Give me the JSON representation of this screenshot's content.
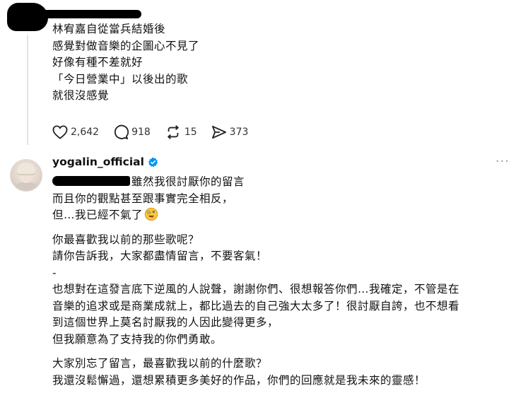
{
  "comment": {
    "lines": [
      "林宥嘉自從當兵結婚後",
      "感覺對做音樂的企圖心不見了",
      "好像有種不差就好",
      "「今日營業中」以後出的歌",
      "就很沒感覺"
    ],
    "actions": {
      "likes": "2,642",
      "replies": "918",
      "reposts": "15",
      "shares": "373"
    }
  },
  "reply": {
    "username": "yogalin_official",
    "more_label": "···",
    "line1_rest": "雖然我很討厭你的留言",
    "line2": "而且你的觀點甚至跟事實完全相反，",
    "line3": "但…我已經不氣了",
    "para2": [
      "你最喜歡我以前的那些歌呢？",
      "請你告訴我，大家都盡情留言，不要客氣！"
    ],
    "separator": "-",
    "para3": [
      "也想對在這發言底下逆風的人說聲，謝謝你們、很想報答你們…我確定，不管是在",
      "音樂的追求或是商業成就上，都比過去的自己強大太多了！很討厭自誇，也不想看",
      "到這個世界上莫名討厭我的人因此變得更多，",
      "但我願意為了支持我的你們勇敢。"
    ],
    "para4": [
      "大家別忘了留言，最喜歡我以前的什麼歌？",
      "我還沒鬆懈過，還想累積更多美好的作品，你們的回應就是我未來的靈感！"
    ]
  },
  "icons": {
    "like": "heart-icon",
    "reply": "comment-icon",
    "repost": "repost-icon",
    "share": "send-icon",
    "verified": "verified-badge-icon",
    "emoji": "zany-face-emoji"
  },
  "colors": {
    "verified": "#0095f6",
    "text": "#111111",
    "muted": "#9a9a9a"
  }
}
